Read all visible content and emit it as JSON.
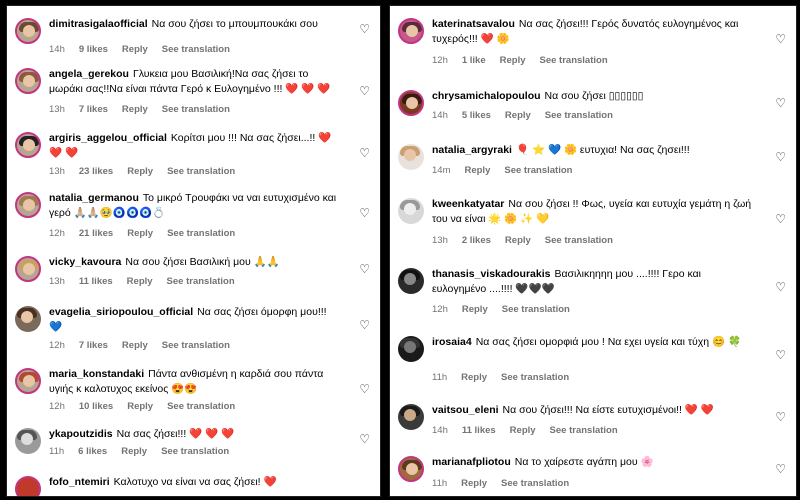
{
  "left_comments": [
    {
      "user": "dimitrasigalaofficial",
      "text": "Να σου ζήσει το μπουμπουκάκι σου",
      "age": "14h",
      "likes": "9 likes",
      "reply": "Reply",
      "translate": "See translation"
    },
    {
      "user": "angela_gerekou",
      "text": "Γλυκεια μου Βασιλική!Να σας ζήσει το μωράκι σας!!Να είναι πάντα Γερό κ Ευλογημένο !!! ❤️ ❤️ ❤️",
      "age": "13h",
      "likes": "7 likes",
      "reply": "Reply",
      "translate": "See translation"
    },
    {
      "user": "argiris_aggelou_official",
      "text": "Κορίτσι μου !!! Να σας ζήσει...!! ❤️ ❤️ ❤️",
      "age": "13h",
      "likes": "23 likes",
      "reply": "Reply",
      "translate": "See translation"
    },
    {
      "user": "natalia_germanou",
      "text": "Το μικρό Τρουφάκι να ναι ευτυχισμένο και γερό 🙏🏼🙏🏼🥹🧿🧿🧿💍",
      "age": "12h",
      "likes": "21 likes",
      "reply": "Reply",
      "translate": "See translation"
    },
    {
      "user": "vicky_kavoura",
      "text": "Να σου ζήσει Βασιλική μου 🙏🙏",
      "age": "13h",
      "likes": "11 likes",
      "reply": "Reply",
      "translate": "See translation"
    },
    {
      "user": "evagelia_siriopoulou_official",
      "text": "Να σας ζήσει όμορφη μου!!! 💙",
      "age": "12h",
      "likes": "7 likes",
      "reply": "Reply",
      "translate": "See translation"
    },
    {
      "user": "maria_konstandaki",
      "text": "Πάντα ανθισμένη η καρδιά σου πάντα υγιής κ καλοτυχος εκείνος 😍😍",
      "age": "12h",
      "likes": "10 likes",
      "reply": "Reply",
      "translate": "See translation"
    },
    {
      "user": "ykapoutzidis",
      "text": "Να σας ζήσει!!! ❤️ ❤️ ❤️",
      "age": "11h",
      "likes": "6 likes",
      "reply": "Reply",
      "translate": "See translation"
    },
    {
      "user": "fofo_ntemiri",
      "text": "Καλοτυχο να είναι να σας ζήσει! ❤️",
      "age": "",
      "likes": "",
      "reply": "",
      "translate": ""
    }
  ],
  "right_comments": [
    {
      "user": "katerinatsavalou",
      "text": "Να σας ζήσει!!! Γερός δυνατός ευλογημένος και τυχερός!!! ❤️ 🌼",
      "age": "12h",
      "likes": "1 like",
      "reply": "Reply",
      "translate": "See translation"
    },
    {
      "user": "chrysamichalopoulou",
      "text": "Να σου ζήσει ▯▯▯▯▯▯",
      "age": "14h",
      "likes": "5 likes",
      "reply": "Reply",
      "translate": "See translation"
    },
    {
      "user": "natalia_argyraki",
      "text": "🎈 ⭐ 💙 🌼 ευτυχια! Να σας ζησει!!!",
      "age": "14m",
      "likes": "",
      "reply": "Reply",
      "translate": "See translation"
    },
    {
      "user": "kweenkatyatar",
      "text": "Να σου ζήσει !! Φως, υγεία και ευτυχία γεμάτη η ζωή του να είναι 🌟 🌼 ✨ 💛",
      "age": "13h",
      "likes": "2 likes",
      "reply": "Reply",
      "translate": "See translation"
    },
    {
      "user": "thanasis_viskadourakis",
      "text": "Βασιλικηηηη μου ....!!!! Γερο και ευλογημένο ....!!!! 🖤🖤🖤",
      "age": "12h",
      "likes": "",
      "reply": "Reply",
      "translate": "See translation"
    },
    {
      "user": "irosaia4",
      "text": "Να σας ζήσει ομορφιά μου ! Να εχει υγεία και τύχη 😊 🍀",
      "age": "11h",
      "likes": "",
      "reply": "Reply",
      "translate": "See translation"
    },
    {
      "user": "vaitsou_eleni",
      "text": "Να σου ζήσει!!! Να είστε ευτυχισμένοι!! ❤️ ❤️",
      "age": "14h",
      "likes": "11 likes",
      "reply": "Reply",
      "translate": "See translation"
    },
    {
      "user": "marianafpliotou",
      "text": "Να το χαίρεστε αγάπη μου 🌸",
      "age": "11h",
      "likes": "",
      "reply": "Reply",
      "translate": "See translation"
    }
  ],
  "icons": {
    "like": "heart-outline-icon"
  }
}
